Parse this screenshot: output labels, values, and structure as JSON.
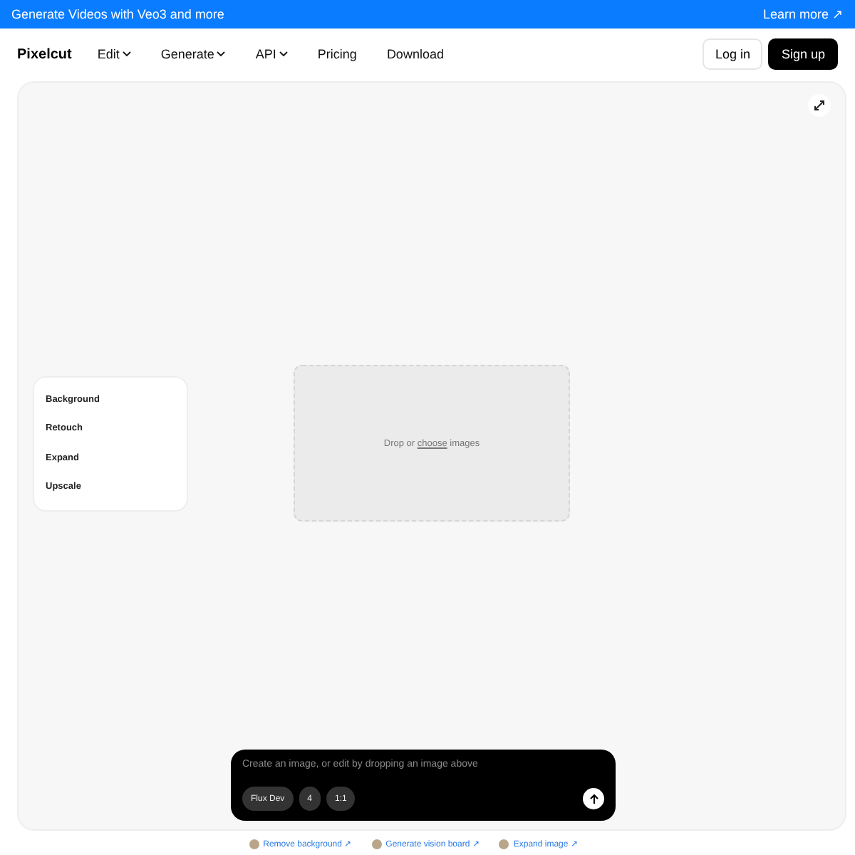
{
  "banner": {
    "text": "Generate Videos with Veo3 and more",
    "link": "Learn more ↗"
  },
  "nav": {
    "logo": "Pixelcut",
    "items": [
      {
        "label": "Edit",
        "dropdown": true
      },
      {
        "label": "Generate",
        "dropdown": true
      },
      {
        "label": "API",
        "dropdown": true
      },
      {
        "label": "Pricing",
        "dropdown": false
      },
      {
        "label": "Download",
        "dropdown": false
      }
    ],
    "login": "Log in",
    "signup": "Sign up"
  },
  "tools": [
    "Background",
    "Retouch",
    "Expand",
    "Upscale"
  ],
  "dropzone": {
    "before": "Drop or ",
    "link": "choose",
    "after": " images"
  },
  "prompt": {
    "placeholder": "Create an image, or edit by dropping an image above",
    "chips": [
      "Flux Dev",
      "4",
      "1:1"
    ]
  },
  "footer_links": [
    "Remove background ↗",
    "Generate vision board ↗",
    "Expand image ↗"
  ]
}
